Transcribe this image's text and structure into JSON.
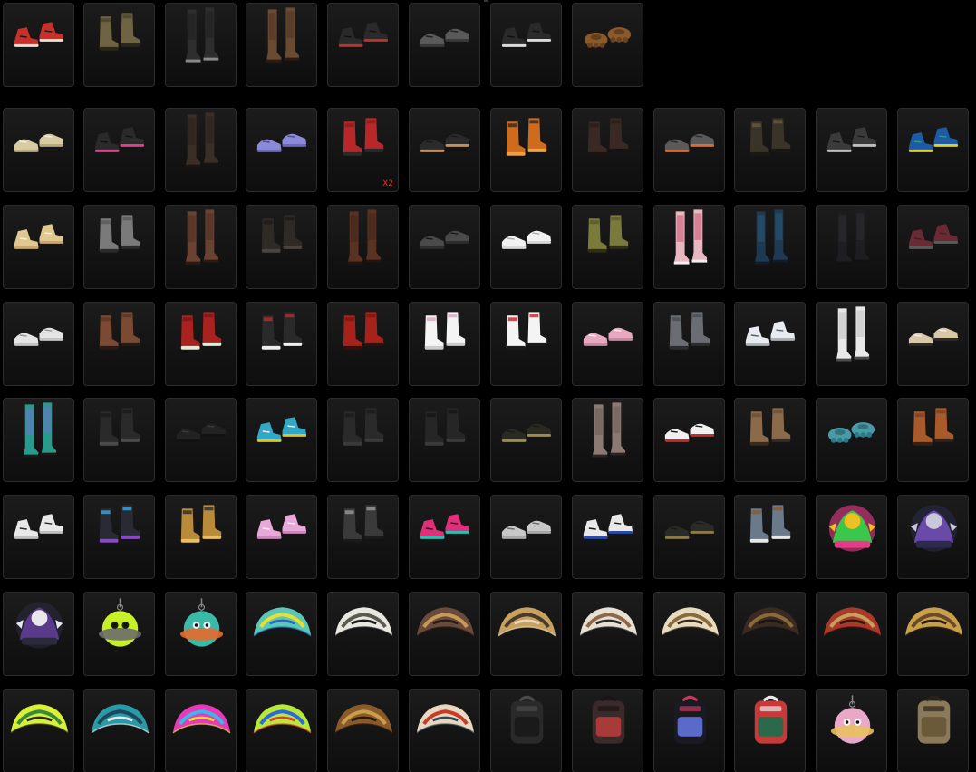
{
  "inventory": {
    "rows": [
      {
        "items": [
          {
            "name": "red-white-high-top-sneakers",
            "kind": "sneaker",
            "colors": [
              "#c8302a",
              "#e8e4de",
              "#1a1a1a"
            ]
          },
          {
            "name": "khaki-combat-boots",
            "kind": "boot",
            "colors": [
              "#6e6444",
              "#4a4430",
              "#2a2618"
            ]
          },
          {
            "name": "black-tall-boots",
            "kind": "tallboot",
            "colors": [
              "#2e2e2e",
              "#1c1c1c",
              "#888888"
            ]
          },
          {
            "name": "brown-knee-boots",
            "kind": "tallboot",
            "colors": [
              "#6b4a32",
              "#4a3222",
              "#2a1c12"
            ]
          },
          {
            "name": "black-red-sneakers",
            "kind": "sneaker",
            "colors": [
              "#2a2a2a",
              "#c0302a",
              "#111111"
            ]
          },
          {
            "name": "gray-slip-on-shoes",
            "kind": "shoe",
            "colors": [
              "#5a5a5a",
              "#3a3a3a",
              "#222222"
            ]
          },
          {
            "name": "black-white-sneakers",
            "kind": "sneaker",
            "colors": [
              "#2a2a2a",
              "#dcdcdc",
              "#111111"
            ]
          },
          {
            "name": "brown-paw-feet",
            "kind": "paw",
            "colors": [
              "#8a5a2a",
              "#6a4220",
              "#3a2410"
            ]
          }
        ]
      },
      {
        "items": [
          {
            "name": "beige-low-sneakers",
            "kind": "shoe",
            "colors": [
              "#d8cba0",
              "#b8aa80",
              "#eeeeee"
            ]
          },
          {
            "name": "black-pink-sneakers",
            "kind": "sneaker",
            "colors": [
              "#2a2a2a",
              "#e0408a",
              "#111111"
            ]
          },
          {
            "name": "dark-tall-leather-boots",
            "kind": "tallboot",
            "colors": [
              "#3a2e26",
              "#2a201a",
              "#1a1410"
            ]
          },
          {
            "name": "lavender-flats",
            "kind": "shoe",
            "colors": [
              "#8a8ad8",
              "#6a6ab8",
              "#4a4a88"
            ]
          },
          {
            "name": "red-ankle-boots",
            "kind": "boot",
            "colors": [
              "#b8282a",
              "#8a1c1c",
              "#2a2a2a"
            ],
            "badge": "X2"
          },
          {
            "name": "black-sandals-tan-sole",
            "kind": "shoe",
            "colors": [
              "#2a2a2a",
              "#c89058",
              "#1a1a1a"
            ]
          },
          {
            "name": "orange-flame-boots",
            "kind": "boot",
            "colors": [
              "#d06a1c",
              "#2a2a2a",
              "#f0a040"
            ]
          },
          {
            "name": "dark-brown-boots",
            "kind": "boot",
            "colors": [
              "#3a2822",
              "#2a1c18",
              "#1a1210"
            ]
          },
          {
            "name": "gray-orange-sneakers",
            "kind": "shoe",
            "colors": [
              "#5a5a5a",
              "#e06a30",
              "#2a2a2a"
            ]
          },
          {
            "name": "camo-combat-boots",
            "kind": "boot",
            "colors": [
              "#3a3428",
              "#6a5a3a",
              "#1a1812"
            ]
          },
          {
            "name": "black-gray-sneakers",
            "kind": "sneaker",
            "colors": [
              "#3a3a3a",
              "#bdbdbd",
              "#1a1a1a"
            ]
          },
          {
            "name": "blue-yellow-sneakers",
            "kind": "sneaker",
            "colors": [
              "#1e5aa8",
              "#e0d020",
              "#2aa070"
            ]
          }
        ]
      },
      {
        "items": [
          {
            "name": "cream-high-tops",
            "kind": "sneaker",
            "colors": [
              "#e0c890",
              "#c8a870",
              "#f0f0f0"
            ]
          },
          {
            "name": "gray-slouch-boots",
            "kind": "boot",
            "colors": [
              "#7a7a7a",
              "#5a5a5a",
              "#2a2a2a"
            ]
          },
          {
            "name": "brown-lace-up-tall-boots",
            "kind": "tallboot",
            "colors": [
              "#6a4232",
              "#4a2c20",
              "#2a1a12"
            ]
          },
          {
            "name": "black-lace-boots",
            "kind": "boot",
            "colors": [
              "#2e2a26",
              "#1e1a16",
              "#4a4440"
            ]
          },
          {
            "name": "brown-leather-tall-boots",
            "kind": "tallboot",
            "colors": [
              "#5a3222",
              "#3e2218",
              "#22140e"
            ]
          },
          {
            "name": "dark-gray-loafers",
            "kind": "shoe",
            "colors": [
              "#4a4a4a",
              "#2e2e2e",
              "#1a1a1a"
            ]
          },
          {
            "name": "white-flats",
            "kind": "shoe",
            "colors": [
              "#f2f2f2",
              "#d8d8d8",
              "#aaaaaa"
            ]
          },
          {
            "name": "olive-mid-boots",
            "kind": "boot",
            "colors": [
              "#7a7a3a",
              "#5a5a2a",
              "#2e2e16"
            ]
          },
          {
            "name": "pink-patterned-tall-socks",
            "kind": "tallboot",
            "colors": [
              "#e8b8c0",
              "#c84a6a",
              "#f0f0f0"
            ]
          },
          {
            "name": "teal-tall-boots",
            "kind": "tallboot",
            "colors": [
              "#1e3a52",
              "#2a5a7a",
              "#101c28"
            ]
          },
          {
            "name": "black-thigh-high-boots",
            "kind": "tallboot",
            "colors": [
              "#1e1e22",
              "#2e2e34",
              "#111111"
            ]
          },
          {
            "name": "maroon-gray-sneakers",
            "kind": "sneaker",
            "colors": [
              "#6a2a34",
              "#5a5a5a",
              "#2a2a2a"
            ]
          }
        ]
      },
      {
        "items": [
          {
            "name": "white-low-sneakers",
            "kind": "shoe",
            "colors": [
              "#e4e4e4",
              "#c4c4c4",
              "#999999"
            ]
          },
          {
            "name": "brown-work-boots",
            "kind": "boot",
            "colors": [
              "#7a4a32",
              "#5a3424",
              "#2a1a12"
            ]
          },
          {
            "name": "red-lace-tall-boots",
            "kind": "boot",
            "colors": [
              "#a82220",
              "#7a1816",
              "#e8e8d8"
            ]
          },
          {
            "name": "black-red-stripe-boots",
            "kind": "boot",
            "colors": [
              "#2a2a2a",
              "#b82a2a",
              "#f0f0f0"
            ]
          },
          {
            "name": "red-ankle-boots-2",
            "kind": "boot",
            "colors": [
              "#a8221c",
              "#7a1812",
              "#3a0c0a"
            ]
          },
          {
            "name": "white-pink-go-go-boots",
            "kind": "boot",
            "colors": [
              "#f4f4f4",
              "#e0a0c0",
              "#cccccc"
            ]
          },
          {
            "name": "white-red-bow-boots",
            "kind": "boot",
            "colors": [
              "#f4f4f4",
              "#c8202a",
              "#1a1a1a"
            ]
          },
          {
            "name": "pink-slippers",
            "kind": "shoe",
            "colors": [
              "#e8a8c0",
              "#c888a0",
              "#f0f0f0"
            ]
          },
          {
            "name": "gray-rugged-boots",
            "kind": "boot",
            "colors": [
              "#6a6e72",
              "#4a4e52",
              "#2a2c2e"
            ]
          },
          {
            "name": "white-winged-sneakers",
            "kind": "sneaker",
            "colors": [
              "#e8ecf0",
              "#a8b0b8",
              "#5a6068"
            ]
          },
          {
            "name": "white-tall-socks-boots",
            "kind": "tallboot",
            "colors": [
              "#e8e8e8",
              "#bcbcbc",
              "#4a4a4a"
            ]
          },
          {
            "name": "beige-strap-sandals",
            "kind": "shoe",
            "colors": [
              "#d8c8a8",
              "#2a2a2a",
              "#f0f0f0"
            ]
          }
        ]
      },
      {
        "items": [
          {
            "name": "teal-checker-socks-purple-shoes",
            "kind": "tallboot",
            "colors": [
              "#2a9a8a",
              "#7a6ad8",
              "#1a1a1a"
            ]
          },
          {
            "name": "black-leather-boots",
            "kind": "boot",
            "colors": [
              "#2a2a2a",
              "#1a1a1a",
              "#4a4a4a"
            ]
          },
          {
            "name": "black-dress-shoes",
            "kind": "shoe",
            "colors": [
              "#222222",
              "#121212",
              "#3a3a3a"
            ]
          },
          {
            "name": "cyan-yellow-sneakers",
            "kind": "sneaker",
            "colors": [
              "#30a8c8",
              "#e8c020",
              "#f0f0f0"
            ]
          },
          {
            "name": "black-ankle-boots",
            "kind": "boot",
            "colors": [
              "#2a2a2a",
              "#1c1c1c",
              "#3a3a3a"
            ]
          },
          {
            "name": "black-pull-on-boots",
            "kind": "boot",
            "colors": [
              "#262626",
              "#161616",
              "#3a3a3a"
            ]
          },
          {
            "name": "black-gold-loafers",
            "kind": "shoe",
            "colors": [
              "#2a2a22",
              "#a08a4a",
              "#1a1a14"
            ]
          },
          {
            "name": "nude-stocking-legs",
            "kind": "tallboot",
            "colors": [
              "#8a7a72",
              "#6a5a52",
              "#2a2220"
            ]
          },
          {
            "name": "white-red-print-slip-ons",
            "kind": "shoe",
            "colors": [
              "#f0f0f0",
              "#c82a2a",
              "#1a1a1a"
            ]
          },
          {
            "name": "tan-slouch-boots",
            "kind": "boot",
            "colors": [
              "#8a6a4a",
              "#6a4e34",
              "#3a2a1c"
            ]
          },
          {
            "name": "teal-paw-slippers",
            "kind": "paw",
            "colors": [
              "#4a9aa8",
              "#2a7a88",
              "#1a4a52"
            ]
          },
          {
            "name": "tan-leather-boots",
            "kind": "boot",
            "colors": [
              "#a85a2a",
              "#7a401e",
              "#3a1e0e"
            ]
          }
        ]
      },
      {
        "items": [
          {
            "name": "white-high-top-sneakers",
            "kind": "sneaker",
            "colors": [
              "#e8e8e8",
              "#c0c0c0",
              "#2a2a2a"
            ]
          },
          {
            "name": "black-blue-platform-boots",
            "kind": "boot",
            "colors": [
              "#2a2a34",
              "#3aa8e0",
              "#8a4ac8"
            ]
          },
          {
            "name": "gold-black-high-tops",
            "kind": "boot",
            "colors": [
              "#b88a3a",
              "#2a2a2a",
              "#e8c060"
            ]
          },
          {
            "name": "pink-sneakers",
            "kind": "sneaker",
            "colors": [
              "#e8a8d8",
              "#c888b8",
              "#f0f0f0"
            ]
          },
          {
            "name": "black-gray-strap-sandals",
            "kind": "boot",
            "colors": [
              "#3a3a3a",
              "#9a9a9a",
              "#1a1a1a"
            ]
          },
          {
            "name": "pink-teal-sandals",
            "kind": "sneaker",
            "colors": [
              "#e0307a",
              "#2ac0b0",
              "#1a1a1a"
            ]
          },
          {
            "name": "gray-white-sneakers",
            "kind": "shoe",
            "colors": [
              "#c8c8c8",
              "#a8a8a8",
              "#6a6a6a"
            ]
          },
          {
            "name": "white-blue-sneakers",
            "kind": "sneaker",
            "colors": [
              "#e8e8e8",
              "#2a4aa8",
              "#1a1a1a"
            ]
          },
          {
            "name": "black-gold-dress-shoes",
            "kind": "shoe",
            "colors": [
              "#2a2a26",
              "#8a7a4a",
              "#1a1a16"
            ]
          },
          {
            "name": "denim-brown-boots",
            "kind": "boot",
            "colors": [
              "#6a7a8a",
              "#8a5a2a",
              "#e8e8e8"
            ]
          },
          {
            "name": "tropical-crocodile-emblem",
            "kind": "emblem",
            "colors": [
              "#3ac84a",
              "#e83a8a",
              "#f0c020"
            ]
          },
          {
            "name": "dj-character-emblem",
            "kind": "emblem",
            "colors": [
              "#6a4aa8",
              "#2a2a4a",
              "#c8c8d8"
            ]
          }
        ]
      },
      {
        "items": [
          {
            "name": "purple-dj-figure-emblem",
            "kind": "emblem",
            "colors": [
              "#5a3a8a",
              "#2a2a3a",
              "#e8e8e8"
            ]
          },
          {
            "name": "neon-worm-charm",
            "kind": "charm",
            "colors": [
              "#c8f02a",
              "#6a6a6a",
              "#1a1a1a"
            ]
          },
          {
            "name": "orange-alien-ufo-charm",
            "kind": "charm",
            "colors": [
              "#3ab8a8",
              "#e86a2a",
              "#f0f0f0"
            ]
          },
          {
            "name": "teal-yellow-graffiti-parachute",
            "kind": "parachute",
            "colors": [
              "#5ac8b8",
              "#e8e02a",
              "#2a6ab8"
            ]
          },
          {
            "name": "white-snake-print-parachute",
            "kind": "parachute",
            "colors": [
              "#e8e8e0",
              "#5a5a50",
              "#1a1a18"
            ]
          },
          {
            "name": "brown-tribal-parachute",
            "kind": "parachute",
            "colors": [
              "#6a4a3a",
              "#c89a5a",
              "#2a1c14"
            ]
          },
          {
            "name": "gold-camo-parachute",
            "kind": "parachute",
            "colors": [
              "#c8a060",
              "#4a3a2a",
              "#e8d8b8"
            ]
          },
          {
            "name": "white-tan-print-parachute",
            "kind": "parachute",
            "colors": [
              "#e8e0d0",
              "#8a6a4a",
              "#2a2a2a"
            ]
          },
          {
            "name": "cream-ornate-parachute",
            "kind": "parachute",
            "colors": [
              "#e8dcc0",
              "#8a6a3a",
              "#3a2a1a"
            ]
          },
          {
            "name": "dark-brown-crest-parachute",
            "kind": "parachute",
            "colors": [
              "#3a2a22",
              "#8a6a3a",
              "#1a1410"
            ]
          },
          {
            "name": "red-gold-parachute",
            "kind": "parachute",
            "colors": [
              "#a83a2a",
              "#c8a05a",
              "#3a1410"
            ]
          },
          {
            "name": "gold-emblem-parachute",
            "kind": "parachute",
            "colors": [
              "#c8a04a",
              "#6a4a2a",
              "#2a1a10"
            ]
          }
        ]
      },
      {
        "items": [
          {
            "name": "neon-yellow-graffiti-parachute",
            "kind": "parachute",
            "colors": [
              "#d8f03a",
              "#3a8a3a",
              "#2a2a2a"
            ]
          },
          {
            "name": "teal-graffiti-parachute",
            "kind": "parachute",
            "colors": [
              "#2a9aa8",
              "#1a4a5a",
              "#e8e8e8"
            ]
          },
          {
            "name": "rainbow-comic-parachute",
            "kind": "parachute",
            "colors": [
              "#e83ab8",
              "#3ab8e8",
              "#e8e02a"
            ]
          },
          {
            "name": "green-blue-comic-parachute",
            "kind": "parachute",
            "colors": [
              "#b8e83a",
              "#2a6ae0",
              "#e83a3a"
            ]
          },
          {
            "name": "brown-gold-parachute",
            "kind": "parachute",
            "colors": [
              "#8a5a2a",
              "#c8a04a",
              "#2a1a0e"
            ]
          },
          {
            "name": "red-dragon-parachute",
            "kind": "parachute",
            "colors": [
              "#e8d8c0",
              "#c83a2a",
              "#2a4a5a"
            ]
          },
          {
            "name": "black-tactical-backpack",
            "kind": "backpack",
            "colors": [
              "#2a2a2a",
              "#1a1a1a",
              "#4a4a4a"
            ]
          },
          {
            "name": "red-floral-backpack",
            "kind": "backpack",
            "colors": [
              "#3a2a2a",
              "#a83a3a",
              "#1a1414"
            ]
          },
          {
            "name": "graffiti-black-backpack",
            "kind": "backpack",
            "colors": [
              "#1a1a22",
              "#5a6ac8",
              "#c83a5a"
            ]
          },
          {
            "name": "red-green-backpack",
            "kind": "backpack",
            "colors": [
              "#c83a3a",
              "#2a6a4a",
              "#e8e8e8"
            ]
          },
          {
            "name": "pink-winged-charm",
            "kind": "charm",
            "colors": [
              "#e8a8c8",
              "#e8c060",
              "#f4f4f4"
            ]
          },
          {
            "name": "tan-field-backpack",
            "kind": "backpack",
            "colors": [
              "#8a7a5a",
              "#6a5a3a",
              "#2a2418"
            ]
          }
        ]
      }
    ]
  }
}
